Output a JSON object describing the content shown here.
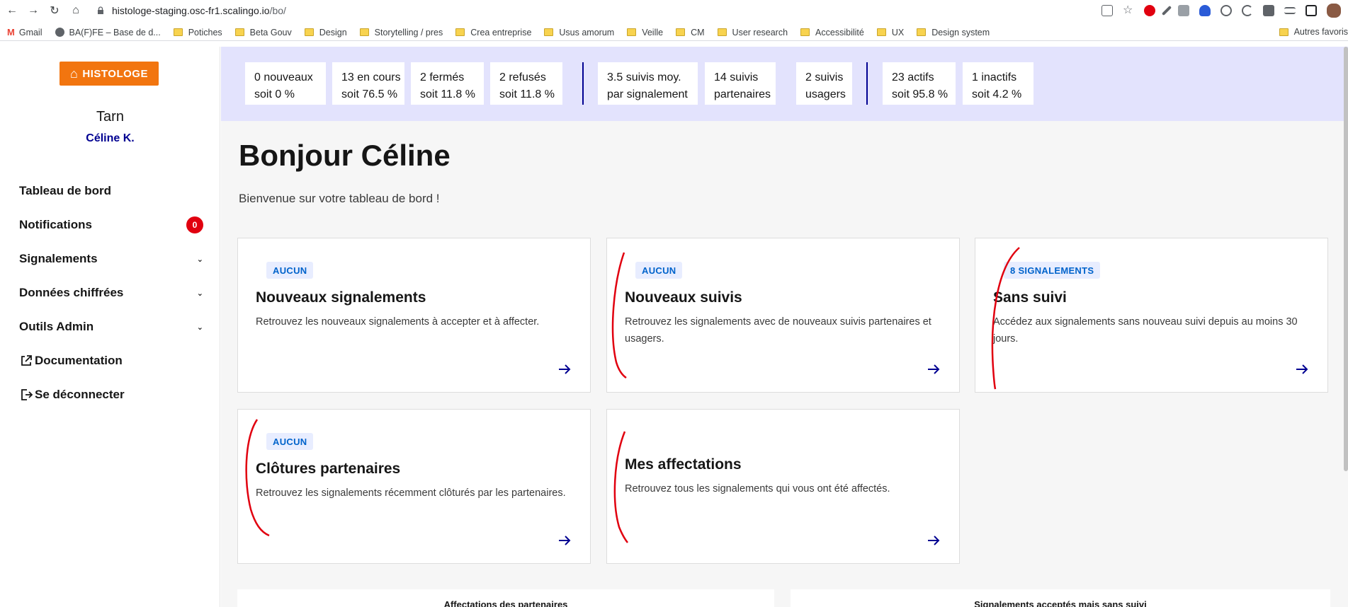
{
  "browser": {
    "url_host": "histologe-staging.osc-fr1.scalingo.io",
    "url_path": "/bo/",
    "bookmarks": [
      {
        "label": "Gmail",
        "icon": "gmail-icon"
      },
      {
        "label": "BA(F)FE – Base de d...",
        "icon": "globe-icon"
      },
      {
        "label": "Potiches",
        "icon": "folder-icon"
      },
      {
        "label": "Beta Gouv",
        "icon": "folder-icon"
      },
      {
        "label": "Design",
        "icon": "folder-icon"
      },
      {
        "label": "Storytelling / pres",
        "icon": "folder-icon"
      },
      {
        "label": "Crea entreprise",
        "icon": "folder-icon"
      },
      {
        "label": "Usus amorum",
        "icon": "folder-icon"
      },
      {
        "label": "Veille",
        "icon": "folder-icon"
      },
      {
        "label": "CM",
        "icon": "folder-icon"
      },
      {
        "label": "User research",
        "icon": "folder-icon"
      },
      {
        "label": "Accessibilité",
        "icon": "folder-icon"
      },
      {
        "label": "UX",
        "icon": "folder-icon"
      },
      {
        "label": "Design system",
        "icon": "folder-icon"
      }
    ],
    "other_bookmarks": "Autres favoris"
  },
  "sidebar": {
    "logo": "HISTOLOGE",
    "territory": "Tarn",
    "user": "Céline K.",
    "items": [
      {
        "label": "Tableau de bord"
      },
      {
        "label": "Notifications",
        "badge": "0"
      },
      {
        "label": "Signalements"
      },
      {
        "label": "Données chiffrées"
      },
      {
        "label": "Outils Admin"
      },
      {
        "label": "Documentation"
      },
      {
        "label": "Se déconnecter"
      }
    ]
  },
  "stats": [
    {
      "line1": "0 nouveaux",
      "line2": "soit 0 %"
    },
    {
      "line1": "13 en cours",
      "line2": "soit 76.5 %"
    },
    {
      "line1": "2 fermés",
      "line2": "soit 11.8 %"
    },
    {
      "line1": "2 refusés",
      "line2": "soit 11.8 %"
    },
    {
      "line1": "3.5 suivis moy.",
      "line2": "par signalement"
    },
    {
      "line1": "14 suivis",
      "line2": "partenaires"
    },
    {
      "line1": "2 suivis",
      "line2": "usagers"
    },
    {
      "line1": "23 actifs",
      "line2": "soit 95.8 %"
    },
    {
      "line1": "1 inactifs",
      "line2": "soit 4.2 %"
    }
  ],
  "main": {
    "greeting": "Bonjour Céline",
    "welcome": "Bienvenue sur votre tableau de bord !",
    "cards": [
      {
        "tag": "AUCUN",
        "title": "Nouveaux signalements",
        "desc": "Retrouvez les nouveaux signalements à accepter et à affecter."
      },
      {
        "tag": "AUCUN",
        "title": "Nouveaux suivis",
        "desc": "Retrouvez les signalements avec de nouveaux suivis partenaires et usagers."
      },
      {
        "tag": "8 SIGNALEMENTS",
        "title": "Sans suivi",
        "desc": "Accédez aux signalements sans nouveau suivi depuis au moins 30 jours."
      },
      {
        "tag": "AUCUN",
        "title": "Clôtures partenaires",
        "desc": "Retrouvez les signalements récemment clôturés par les partenaires."
      },
      {
        "tag": "",
        "title": "Mes affectations",
        "desc": "Retrouvez tous les signalements qui vous ont été affectés."
      }
    ],
    "panels": [
      {
        "title": "Affectations des partenaires"
      },
      {
        "title": "Signalements acceptés mais sans suivi"
      }
    ]
  },
  "colors": {
    "brand": "#000091",
    "logo": "#f2750f",
    "badge": "#e1000f",
    "tag_bg": "#e8edff",
    "tag_text": "#0063cb",
    "annotation": "#e1000f"
  }
}
